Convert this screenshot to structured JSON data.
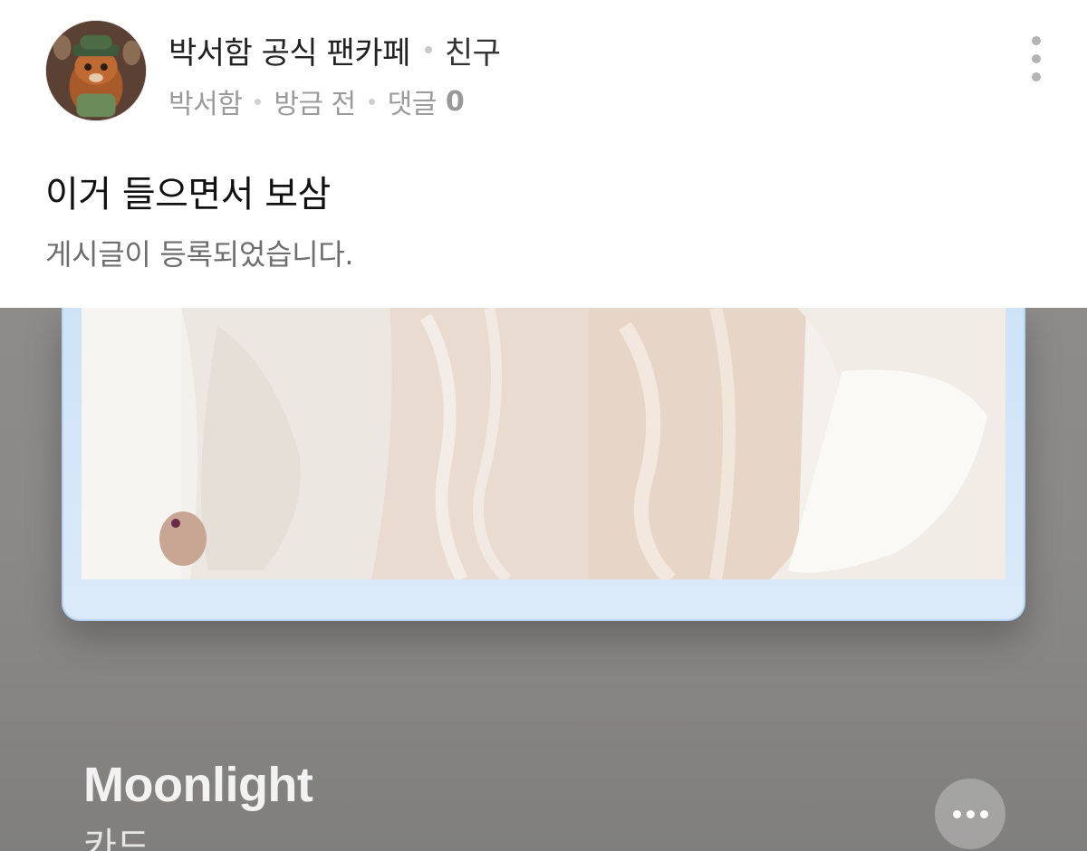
{
  "post": {
    "cafe_name": "박서함 공식 팬카페",
    "relation": "친구",
    "author": "박서함",
    "time": "방금 전",
    "comment_label": "댓글",
    "comment_count": "0",
    "title": "이거 들으면서 보삼",
    "status": "게시글이 등록되었습니다."
  },
  "music": {
    "track_title": "Moonlight",
    "artist": "카드"
  },
  "icons": {
    "menu": "kebab-icon",
    "more": "ellipsis-icon",
    "avatar": "avatar-image"
  },
  "colors": {
    "frame": "#cfe3f7",
    "background": "#8a8987",
    "text_primary": "#111111",
    "text_meta": "#9b9b9b"
  }
}
